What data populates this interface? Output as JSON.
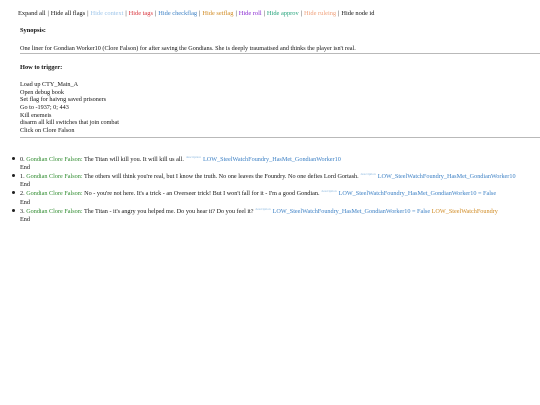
{
  "toolbar": {
    "items": [
      {
        "label": "Expand all",
        "color": "#111111"
      },
      {
        "label": "Hide all flags",
        "color": "#111111"
      },
      {
        "label": "Hide context",
        "color": "#9fc6ea"
      },
      {
        "label": "Hide tags",
        "color": "#d9363e"
      },
      {
        "label": "Hide checkflag",
        "color": "#3a7fc4"
      },
      {
        "label": "Hide setflag",
        "color": "#d08a22"
      },
      {
        "label": "Hide roll",
        "color": "#8a2bd2"
      },
      {
        "label": "Hide approv",
        "color": "#24a37a"
      },
      {
        "label": "Hide ruleing",
        "color": "#f0a07a"
      },
      {
        "label": "Hide node id",
        "color": "#111111"
      }
    ]
  },
  "synopsis": {
    "heading": "Synopsis:",
    "text": "One liner for Gondian Worker10 (Clore Falson) for after saving the Gondians. She is deeply traumatised and thinks the player isn't real."
  },
  "trigger": {
    "heading": "How to trigger:",
    "lines": [
      "Load up CTY_Main_A",
      "Open debug book",
      "Set flag for haivng saved prisoners",
      "Go to -1937; 0; 443",
      "Kill enemeis",
      "disarm all kill switches that join combat",
      "Click on Clore Falson"
    ]
  },
  "dialog": [
    {
      "index": "0.",
      "speaker": "Gondian Clore Falson:",
      "text": "The Titan will kill you. It will kill us all.",
      "sup": "description",
      "flag": "LOW_SteelWatchFoundry_HasMet_GondianWorker10",
      "flag_extra": "",
      "end": "End"
    },
    {
      "index": "1.",
      "speaker": "Gondian Clore Falson:",
      "text": "The others will think you're real, but I know the truth. No one leaves the Foundry. No one defies Lord Gortash.",
      "sup": "description",
      "flag": "LOW_SteelWatchFoundry_HasMet_GondianWorker10",
      "flag_extra": "",
      "end": "End"
    },
    {
      "index": "2.",
      "speaker": "Gondian Clore Falson:",
      "text": "No - you're not here. It's a trick - an Overseer trick! But I won't fall for it - I'm a good Gondian.",
      "sup": "description",
      "flag": "LOW_SteelWatchFoundry_HasMet_GondianWorker10 = False",
      "flag_extra": "",
      "end": "End"
    },
    {
      "index": "3.",
      "speaker": "Gondian Clore Falson:",
      "text": "The Titan - it's angry you helped me. Do you hear it? Do you feel it?",
      "sup": "description",
      "flag": "LOW_SteelWatchFoundry_HasMet_GondianWorker10 = False",
      "flag_extra": "LOW_SteelWatchFoundry",
      "end": "End"
    }
  ]
}
